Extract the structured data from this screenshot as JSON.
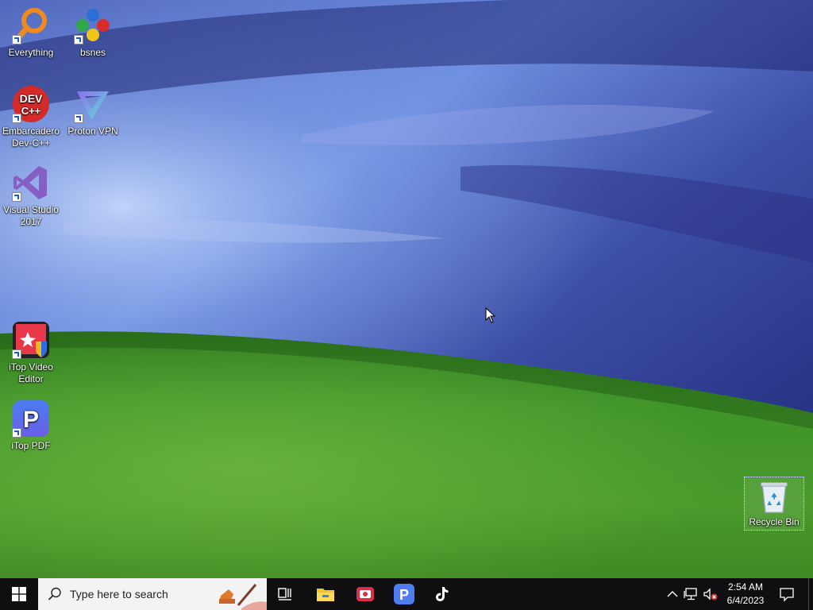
{
  "desktop": {
    "icons": [
      {
        "label": "Everything",
        "icon": "everything-search-icon"
      },
      {
        "label": "bsnes",
        "icon": "bsnes-icon"
      },
      {
        "label": "Embarcadero Dev-C++",
        "icon": "devcpp-icon"
      },
      {
        "label": "Proton VPN",
        "icon": "protonvpn-icon"
      },
      {
        "label": "Visual Studio 2017",
        "icon": "visual-studio-icon"
      },
      {
        "label": "iTop Video Editor",
        "icon": "itop-video-editor-icon"
      },
      {
        "label": "iTop PDF",
        "icon": "itop-pdf-icon"
      },
      {
        "label": "Recycle Bin",
        "icon": "recycle-bin-icon"
      }
    ],
    "devcpp_badge": {
      "line1": "DEV",
      "line2": "C++"
    },
    "pdf_letter": "P"
  },
  "taskbar": {
    "search_placeholder": "Type here to search",
    "clock": {
      "time": "2:54 AM",
      "date": "6/4/2023"
    },
    "pinned": [
      "task-view-icon",
      "file-explorer-icon",
      "itop-screen-recorder-icon",
      "itop-pdf-icon",
      "tiktok-icon"
    ],
    "tray": [
      "chevron-up-icon",
      "network-icon",
      "volume-muted-icon",
      "notification-icon"
    ]
  }
}
